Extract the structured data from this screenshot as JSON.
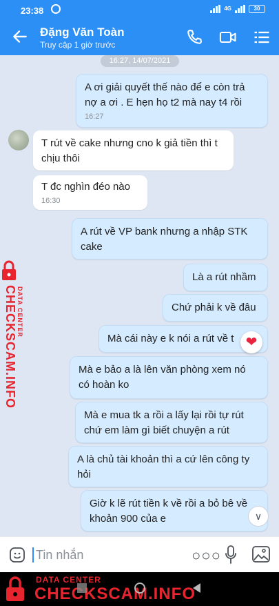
{
  "status_bar": {
    "time": "23:38",
    "network": "4G",
    "battery": "30"
  },
  "header": {
    "contact_name": "Đặng Văn Toàn",
    "last_seen": "Truy cập 1 giờ trước"
  },
  "chat": {
    "date_separator": "16:27, 14/07/2021",
    "messages": [
      {
        "sender": "me",
        "text": "A ơi giải quyết thế nào để e còn trả nợ a ơi . E hẹn họ t2 mà nay t4 rồi",
        "time": "16:27"
      },
      {
        "sender": "them",
        "text": "T rút về cake nhưng cno k giả tiền thì t chịu thôi",
        "time": ""
      },
      {
        "sender": "them",
        "text": "T đc nghìn đéo nào",
        "time": "16:30"
      },
      {
        "sender": "me",
        "text": "A rút về VP bank nhưng a nhập STK cake",
        "time": ""
      },
      {
        "sender": "me",
        "text": "Là a rút nhầm",
        "time": ""
      },
      {
        "sender": "me",
        "text": "Chứ phải k về đâu",
        "time": ""
      },
      {
        "sender": "me",
        "text": "Mà cái này e k nói a rút về t",
        "time": ""
      },
      {
        "sender": "me",
        "text": "Mà e bảo a là lên văn phòng xem nó có hoàn ko",
        "time": ""
      },
      {
        "sender": "me",
        "text": "Mà e mua tk a rồi a lấy lại rồi tự rút chứ em làm gì biết chuyện a rút",
        "time": ""
      },
      {
        "sender": "me",
        "text": "A là chủ tài khoản thì a cứ lên công ty hỏi",
        "time": ""
      },
      {
        "sender": "me",
        "text": "Giờ k lẽ rút tiền k về rồi a bỏ bê về khoản 900 của e",
        "time": ""
      }
    ],
    "reaction": "heart"
  },
  "input": {
    "placeholder": "Tin nhắn"
  },
  "watermark": {
    "brand": "CHECKSCAM.INFO",
    "tagline": "DATA CENTER"
  },
  "colors": {
    "header": "#2b8ff5",
    "chat_bg": "#dde6f2",
    "my_bubble": "#d5ebff",
    "watermark": "#e8242f"
  },
  "icons": [
    "back-arrow-icon",
    "phone-icon",
    "video-call-icon",
    "menu-icon",
    "emoji-icon",
    "more-icon",
    "mic-icon",
    "image-icon",
    "heart-icon",
    "chevron-down-icon",
    "lock-icon"
  ]
}
